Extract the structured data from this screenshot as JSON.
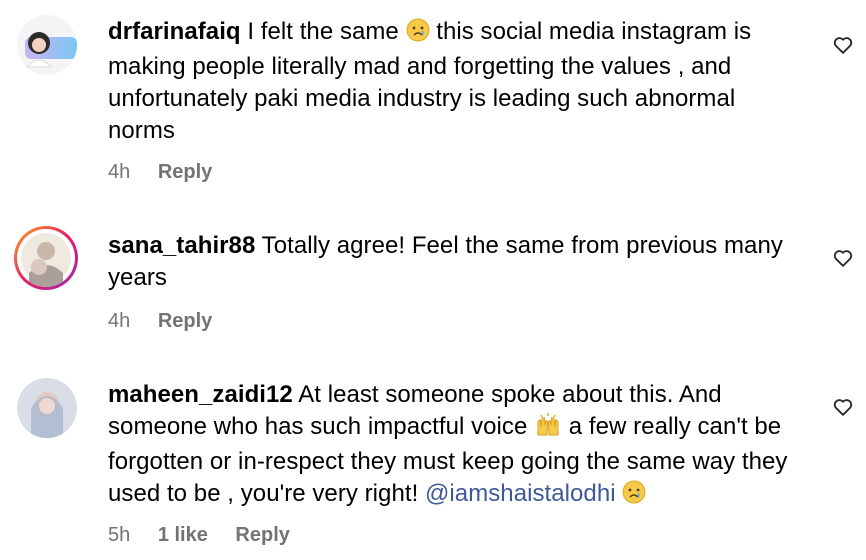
{
  "comments": [
    {
      "username": "drfarinafaiq",
      "text_1": "I felt the same",
      "text_2": "this social media instagram is making people literally mad and forgetting the values , and unfortunately paki media industry is leading such abnormal norms",
      "emoji_1": "crying-face",
      "time": "4h",
      "reply": "Reply"
    },
    {
      "username": "sana_tahir88",
      "text": "Totally agree! Feel the same from previous many years",
      "time": "4h",
      "reply": "Reply",
      "story_ring": true
    },
    {
      "username": "maheen_zaidi12",
      "text_1": "At least someone spoke about this. And someone who has such impactful voice",
      "emoji_1": "raising-hands",
      "text_2": "a few really can't be forgotten or in-respect they must keep going the same way they used to be , you're very right!",
      "mention": "@iamshaistalodhi",
      "emoji_2": "crying-face",
      "time": "5h",
      "likes": "1 like",
      "reply": "Reply"
    }
  ],
  "colors": {
    "text": "#000000",
    "meta": "#737373",
    "mention": "#3f5998",
    "story_ring_start": "#f9a825",
    "story_ring_end": "#c2185b"
  }
}
